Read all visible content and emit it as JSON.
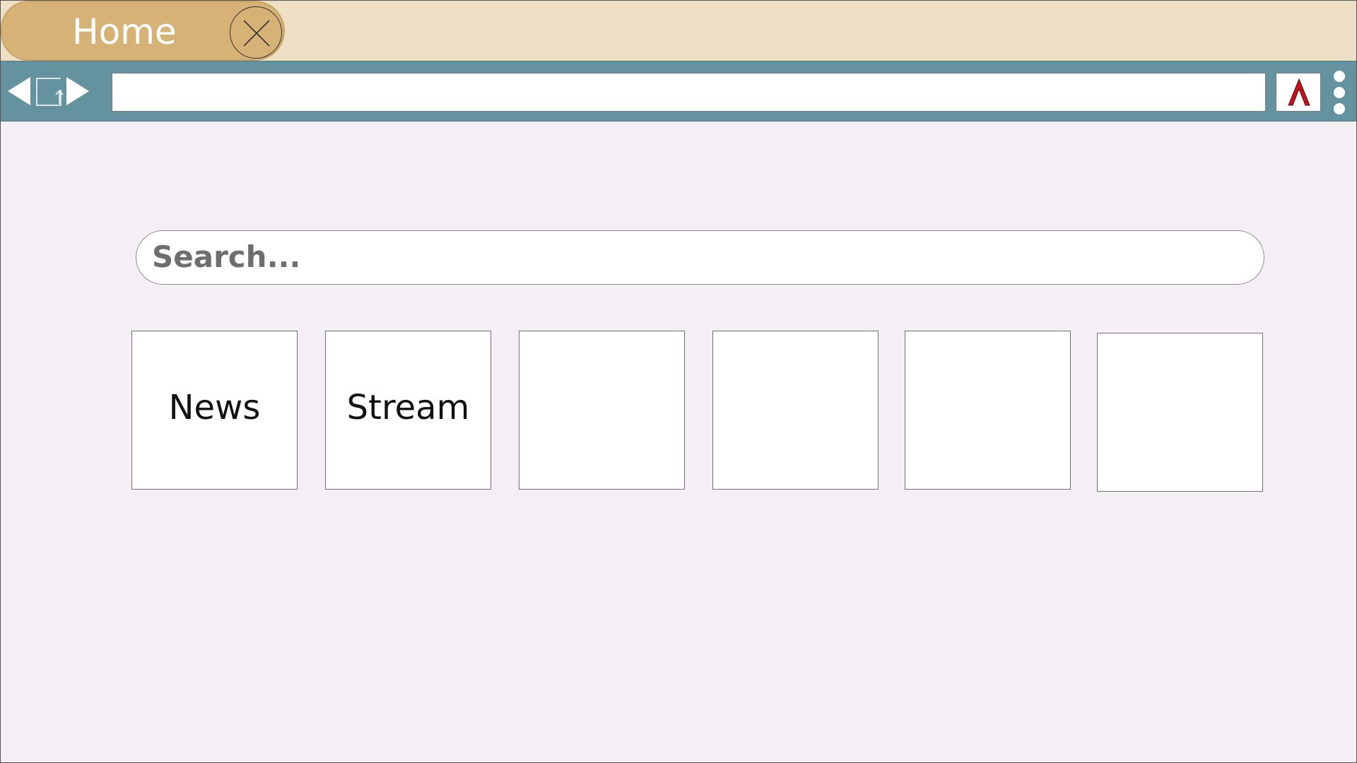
{
  "tab": {
    "title": "Home",
    "close_icon": "close-icon"
  },
  "toolbar": {
    "back_icon": "back-arrow-icon",
    "home_icon": "home-icon",
    "forward_icon": "forward-arrow-icon",
    "address_value": "",
    "extension_icon": "caret-up-icon",
    "extension_color": "#c0141c",
    "menu_icon": "vertical-dots-menu-icon"
  },
  "main": {
    "search": {
      "placeholder": "Search..."
    },
    "tiles": [
      {
        "label": "News"
      },
      {
        "label": "Stream"
      },
      {
        "label": ""
      },
      {
        "label": ""
      },
      {
        "label": ""
      },
      {
        "label": ""
      }
    ]
  },
  "colors": {
    "tab_strip": "#ede0c4",
    "active_tab": "#d6b277",
    "toolbar": "#64939f",
    "page_background": "#f3eff5"
  }
}
